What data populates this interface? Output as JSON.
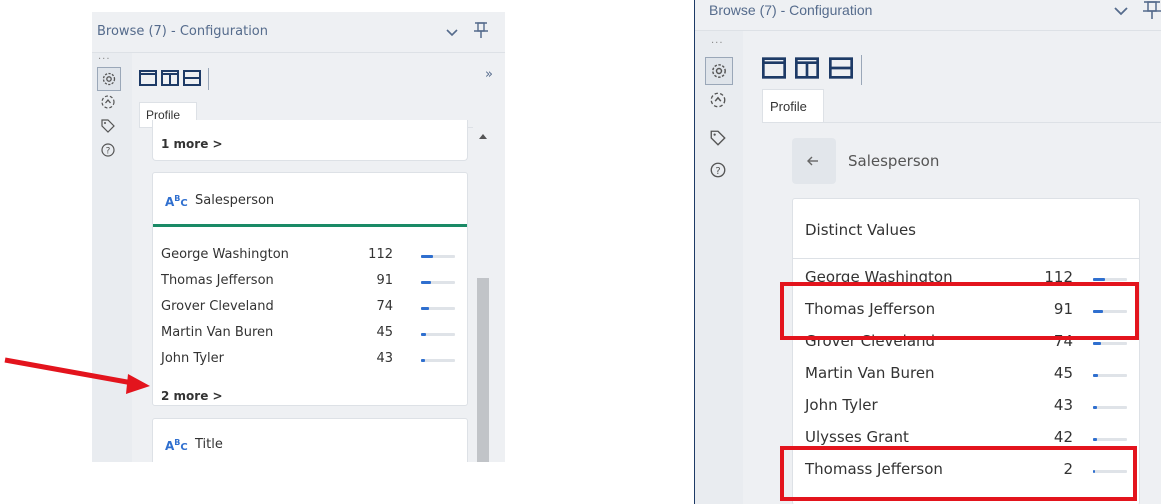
{
  "left_panel": {
    "title": "Browse (7) - Configuration",
    "ellipsis": "...",
    "collapse_glyph": "»",
    "tab_profile": "Profile",
    "top_card": {
      "more_label": "1 more >"
    },
    "field_card": {
      "field_name": "Salesperson",
      "field_type_icon": "abc-string-icon",
      "rows": [
        {
          "name": "George Washington",
          "count": "112",
          "fraction": 0.35
        },
        {
          "name": "Thomas Jefferson",
          "count": "91",
          "fraction": 0.28
        },
        {
          "name": "Grover Cleveland",
          "count": "74",
          "fraction": 0.23
        },
        {
          "name": "Martin Van Buren",
          "count": "45",
          "fraction": 0.14
        },
        {
          "name": "John Tyler",
          "count": "43",
          "fraction": 0.13
        }
      ],
      "more_label": "2 more >"
    },
    "next_card": {
      "field_name": "Title"
    }
  },
  "right_panel": {
    "title": "Browse (7) - Configuration",
    "ellipsis": "...",
    "tab_profile": "Profile",
    "back_label": "Salesperson",
    "distinct_header": "Distinct Values",
    "rows": [
      {
        "name": "George Washington",
        "count": "112",
        "fraction": 0.35
      },
      {
        "name": "Thomas Jefferson",
        "count": "91",
        "fraction": 0.28
      },
      {
        "name": "Grover Cleveland",
        "count": "74",
        "fraction": 0.23
      },
      {
        "name": "Martin Van Buren",
        "count": "45",
        "fraction": 0.14
      },
      {
        "name": "John Tyler",
        "count": "43",
        "fraction": 0.13
      },
      {
        "name": "Ulysses Grant",
        "count": "42",
        "fraction": 0.13
      },
      {
        "name": "Thomass Jefferson",
        "count": "2",
        "fraction": 0.01
      }
    ]
  },
  "colors": {
    "accent_green": "#1a8a66",
    "bar_fill": "#2f6fcf",
    "highlight_red": "#e3141d",
    "title_blue": "#556b8c"
  }
}
